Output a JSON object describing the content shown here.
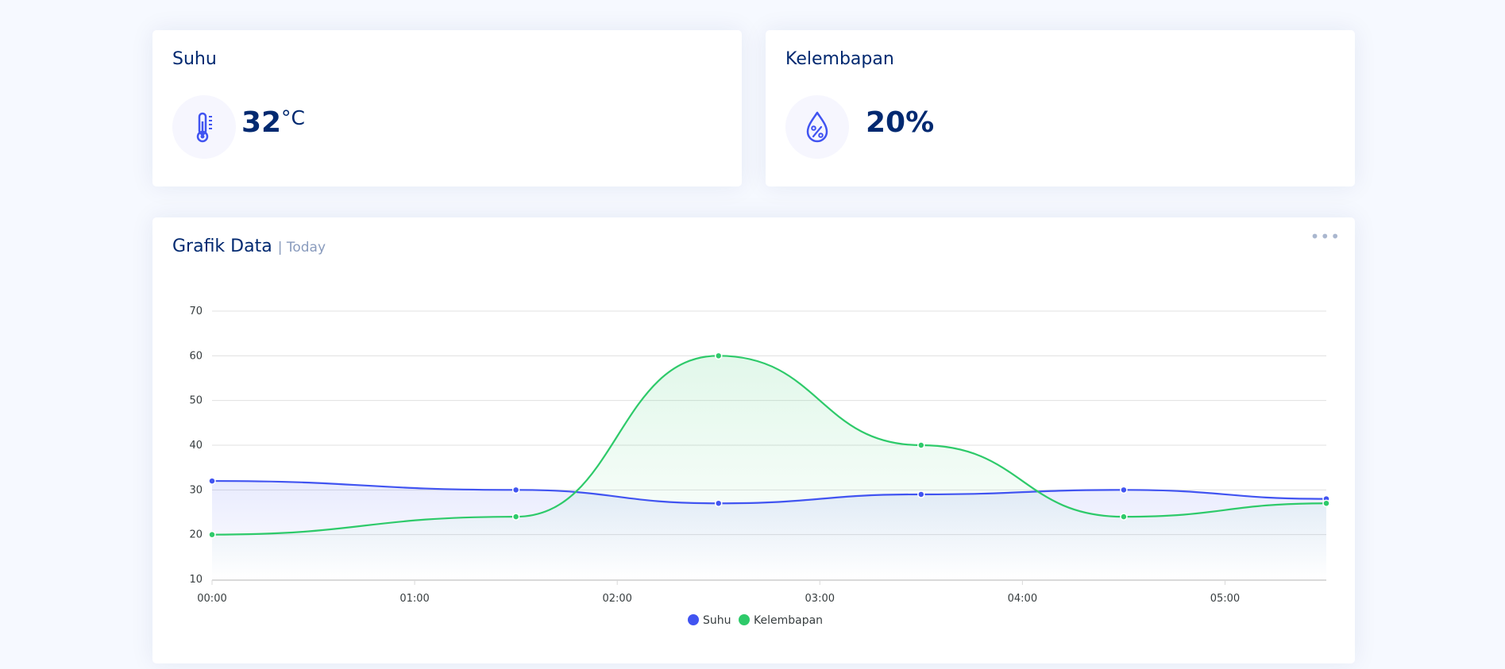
{
  "temperature_card": {
    "title": "Suhu",
    "value": "32",
    "unit": "°C",
    "icon": "thermometer-icon"
  },
  "humidity_card": {
    "title": "Kelembapan",
    "value": "20%",
    "icon": "droplet-percent-icon"
  },
  "chart_card": {
    "title": "Grafik Data",
    "subtitle": "| Today",
    "menu_icon": "more-icon"
  },
  "colors": {
    "suhu": "#4154f1",
    "kelembapan": "#2eca6a"
  },
  "chart_data": {
    "type": "area",
    "xlim": [
      0,
      330
    ],
    "ylim": [
      10,
      70
    ],
    "x_ticks": [
      0,
      60,
      120,
      180,
      240,
      300
    ],
    "x_tick_labels": [
      "00:00",
      "01:00",
      "02:00",
      "03:00",
      "04:00",
      "05:00"
    ],
    "y_ticks": [
      10,
      20,
      30,
      40,
      50,
      60,
      70
    ],
    "x": [
      0,
      90,
      150,
      210,
      270,
      330
    ],
    "series": [
      {
        "name": "Suhu",
        "values": [
          32,
          30,
          27,
          29,
          30,
          28
        ]
      },
      {
        "name": "Kelembapan",
        "values": [
          20,
          24,
          60,
          40,
          24,
          27
        ]
      }
    ],
    "grid": true,
    "legend_position": "bottom"
  }
}
